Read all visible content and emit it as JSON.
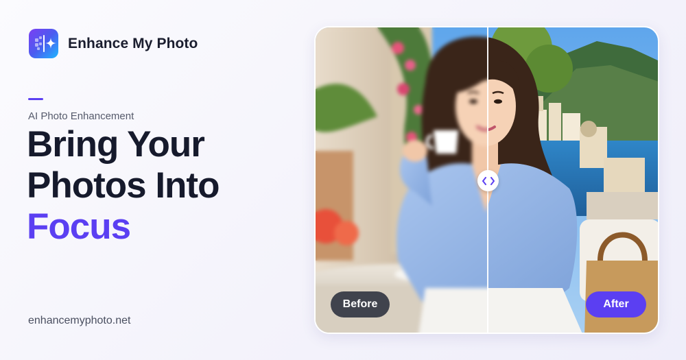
{
  "brand": {
    "name": "Enhance My Photo",
    "logo_icon": "sparkle-icon"
  },
  "hero": {
    "eyebrow": "AI Photo Enhancement",
    "headline_line1": "Bring Your",
    "headline_line2": "Photos Into",
    "headline_accent": "Focus"
  },
  "footer": {
    "url": "enhancemyphoto.net"
  },
  "comparison": {
    "before_label": "Before",
    "after_label": "After",
    "handle_icon": "chevrons-left-right-icon",
    "split_position": 0.5
  },
  "colors": {
    "accent": "#5b3ff2",
    "text_dark": "#161a2c",
    "before_pill": "#262a38"
  }
}
